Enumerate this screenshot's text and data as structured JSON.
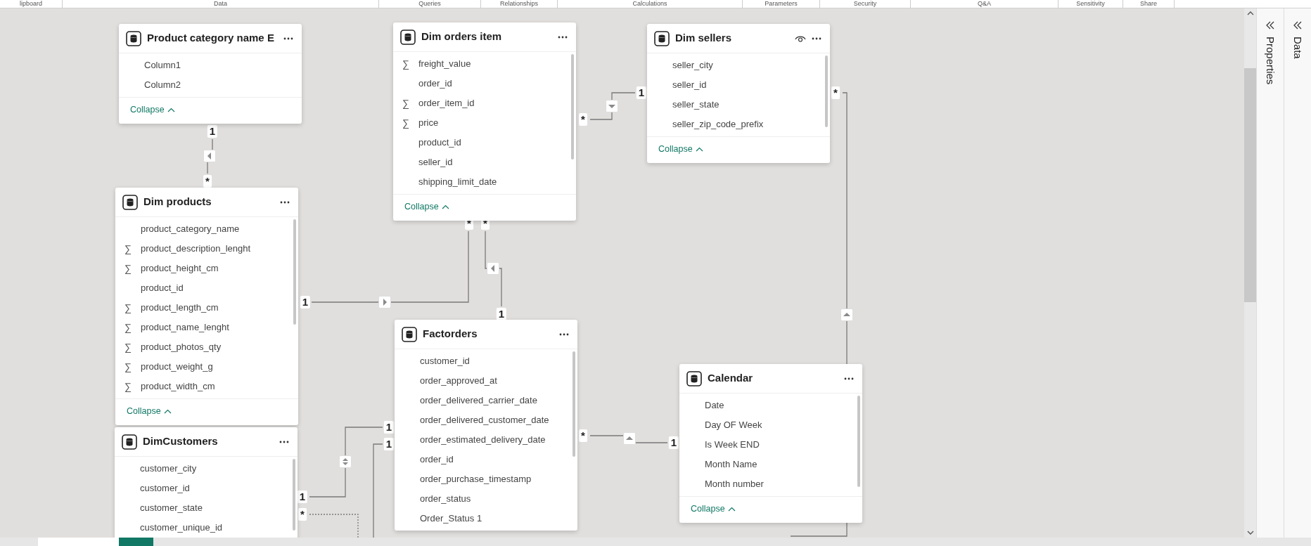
{
  "ribbon_groups": [
    "lipboard",
    "Data",
    "Queries",
    "Relationships",
    "Calculations",
    "Parameters",
    "Security",
    "Q&A",
    "Sensitivity",
    "Share"
  ],
  "tables": [
    {
      "name": "Product category name E",
      "hidden": false,
      "scrollbar": false,
      "fields": [
        {
          "name": "Column1"
        },
        {
          "name": "Column2"
        }
      ],
      "collapse": "Collapse"
    },
    {
      "name": "Dim orders item",
      "hidden": false,
      "scrollbar": true,
      "fields": [
        {
          "name": "freight_value",
          "icon": "∑"
        },
        {
          "name": "order_id"
        },
        {
          "name": "order_item_id",
          "icon": "∑"
        },
        {
          "name": "price",
          "icon": "∑"
        },
        {
          "name": "product_id"
        },
        {
          "name": "seller_id"
        },
        {
          "name": "shipping_limit_date"
        }
      ],
      "collapse": "Collapse"
    },
    {
      "name": "Dim sellers",
      "hidden": true,
      "scrollbar": true,
      "fields": [
        {
          "name": "seller_city"
        },
        {
          "name": "seller_id"
        },
        {
          "name": "seller_state"
        },
        {
          "name": "seller_zip_code_prefix"
        }
      ],
      "collapse": "Collapse"
    },
    {
      "name": "Dim products",
      "hidden": false,
      "scrollbar": true,
      "fields": [
        {
          "name": "product_category_name"
        },
        {
          "name": "product_description_lenght",
          "icon": "∑"
        },
        {
          "name": "product_height_cm",
          "icon": "∑"
        },
        {
          "name": "product_id"
        },
        {
          "name": "product_length_cm",
          "icon": "∑"
        },
        {
          "name": "product_name_lenght",
          "icon": "∑"
        },
        {
          "name": "product_photos_qty",
          "icon": "∑"
        },
        {
          "name": "product_weight_g",
          "icon": "∑"
        },
        {
          "name": "product_width_cm",
          "icon": "∑"
        }
      ],
      "collapse": "Collapse"
    },
    {
      "name": "Factorders",
      "hidden": false,
      "scrollbar": true,
      "fields": [
        {
          "name": "customer_id"
        },
        {
          "name": "order_approved_at"
        },
        {
          "name": "order_delivered_carrier_date"
        },
        {
          "name": "order_delivered_customer_date"
        },
        {
          "name": "order_estimated_delivery_date"
        },
        {
          "name": "order_id"
        },
        {
          "name": "order_purchase_timestamp"
        },
        {
          "name": "order_status"
        },
        {
          "name": "Order_Status 1"
        }
      ]
    },
    {
      "name": "Calendar",
      "hidden": false,
      "scrollbar": true,
      "fields": [
        {
          "name": "Date"
        },
        {
          "name": "Day OF Week"
        },
        {
          "name": "Is Week END"
        },
        {
          "name": "Month Name"
        },
        {
          "name": "Month number"
        }
      ],
      "collapse": "Collapse"
    },
    {
      "name": "DimCustomers",
      "hidden": false,
      "scrollbar": true,
      "fields": [
        {
          "name": "customer_city"
        },
        {
          "name": "customer_id"
        },
        {
          "name": "customer_state"
        },
        {
          "name": "customer_unique_id"
        }
      ]
    }
  ],
  "relationships": [
    {
      "ends": [
        "1",
        "*"
      ],
      "kind": "left",
      "dashed": false
    },
    {
      "ends": [
        "1",
        "*"
      ],
      "kind": "right",
      "dashed": false
    },
    {
      "ends": [
        "*",
        "1"
      ],
      "kind": "left",
      "dashed": false
    },
    {
      "ends": [
        "*",
        "1"
      ],
      "kind": "down",
      "dashed": false
    },
    {
      "ends": [
        "*"
      ],
      "kind": "up",
      "dashed": false
    },
    {
      "ends": [
        "*",
        "1"
      ],
      "kind": "up",
      "dashed": false
    },
    {
      "ends": [
        "1",
        "1"
      ],
      "kind": "both",
      "dashed": false
    },
    {
      "ends": [
        "*"
      ],
      "kind": "plain",
      "dashed": true
    },
    {
      "ends": [
        "1"
      ],
      "kind": "plain",
      "dashed": false
    }
  ],
  "panes": [
    {
      "label": "Properties"
    },
    {
      "label": "Data"
    }
  ]
}
